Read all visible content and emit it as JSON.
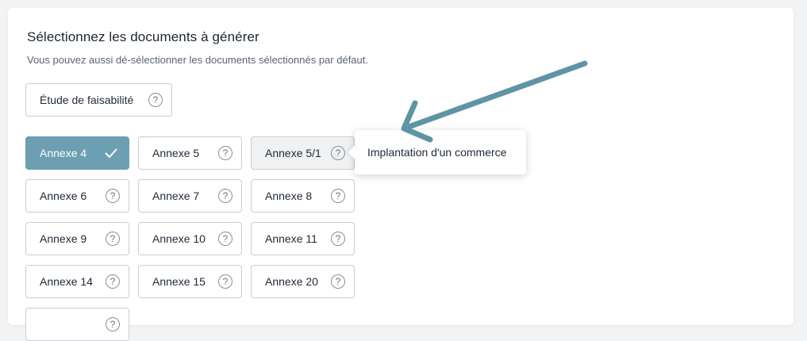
{
  "section": {
    "title": "Sélectionnez les documents à générer",
    "subtitle": "Vous pouvez aussi dé-sélectionner les documents sélectionnés par défaut."
  },
  "documents": [
    {
      "label": "Étude de faisabilité",
      "selected": false
    },
    {
      "label": "Annexe 4",
      "selected": true
    },
    {
      "label": "Annexe 5",
      "selected": false
    },
    {
      "label": "Annexe 5/1",
      "selected": false,
      "hovered": true
    },
    {
      "label": "Annexe 6",
      "selected": false
    },
    {
      "label": "Annexe 7",
      "selected": false
    },
    {
      "label": "Annexe 8",
      "selected": false
    },
    {
      "label": "Annexe 9",
      "selected": false
    },
    {
      "label": "Annexe 10",
      "selected": false
    },
    {
      "label": "Annexe 11",
      "selected": false
    },
    {
      "label": "Annexe 14",
      "selected": false
    },
    {
      "label": "Annexe 15",
      "selected": false
    },
    {
      "label": "Annexe 20",
      "selected": false
    }
  ],
  "help_glyph": "?",
  "tooltip": {
    "text": "Implantation d'un commerce"
  },
  "icons": {
    "help": "question-circle-icon",
    "check": "check-icon",
    "annotation": "arrow-annotation"
  },
  "colors": {
    "selected_bg": "#6c9fb1",
    "annotation_arrow": "#5f94a5",
    "border": "#c9ccd1"
  }
}
